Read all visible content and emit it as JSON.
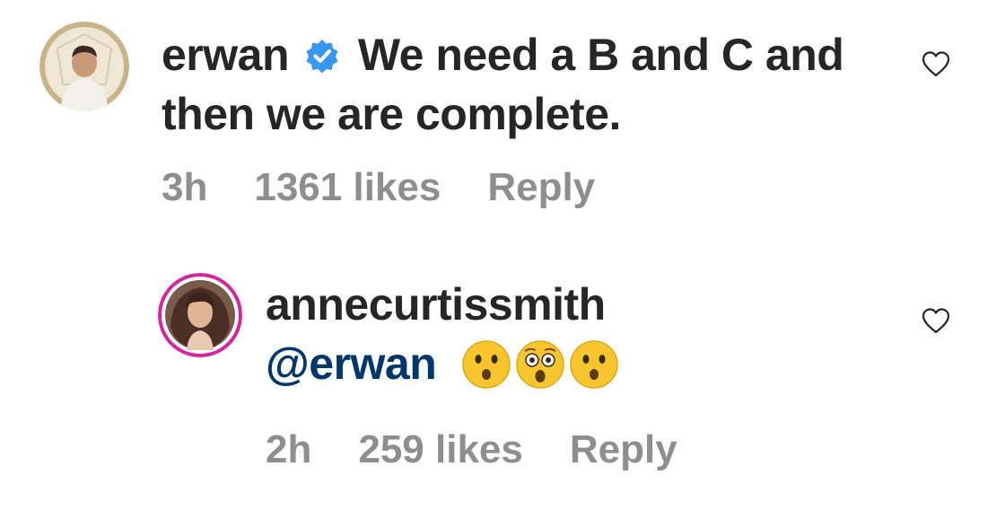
{
  "comments": [
    {
      "username": "erwan",
      "verified": true,
      "text": "We need a B and C and then we are complete.",
      "time": "3h",
      "likes": "1361 likes",
      "reply_label": "Reply",
      "avatar_icon": "profile-photo-man-white-shirt",
      "liked": false
    },
    {
      "username": "annecurtissmith",
      "verified": false,
      "mention": "@erwan",
      "emojis": [
        "hushed-face",
        "astonished-face",
        "hushed-face"
      ],
      "time": "2h",
      "likes": "259 likes",
      "reply_label": "Reply",
      "avatar_icon": "profile-photo-woman-long-hair",
      "story_ring_color": "#d6249f",
      "liked": false
    }
  ],
  "colors": {
    "text": "#262626",
    "meta": "#8e8e8e",
    "mention": "#00376b",
    "verified": "#3897f0"
  }
}
